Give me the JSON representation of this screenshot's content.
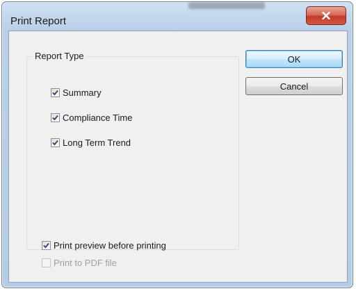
{
  "dialog": {
    "title": "Print Report",
    "close_icon": "close-x-icon"
  },
  "report_type": {
    "label": "Report Type",
    "options": [
      {
        "label": "Summary",
        "checked": true
      },
      {
        "label": "Compliance Time",
        "checked": true
      },
      {
        "label": "Long Term Trend",
        "checked": true
      }
    ]
  },
  "print_options": [
    {
      "label": "Print preview before printing",
      "checked": true,
      "enabled": true
    },
    {
      "label": "Print to PDF file",
      "checked": false,
      "enabled": false
    }
  ],
  "buttons": {
    "ok_label": "OK",
    "cancel_label": "Cancel"
  },
  "colors": {
    "title_bar": "#b9d0e8",
    "close_button": "#c23a28",
    "default_button_border": "#3c7fb1"
  }
}
